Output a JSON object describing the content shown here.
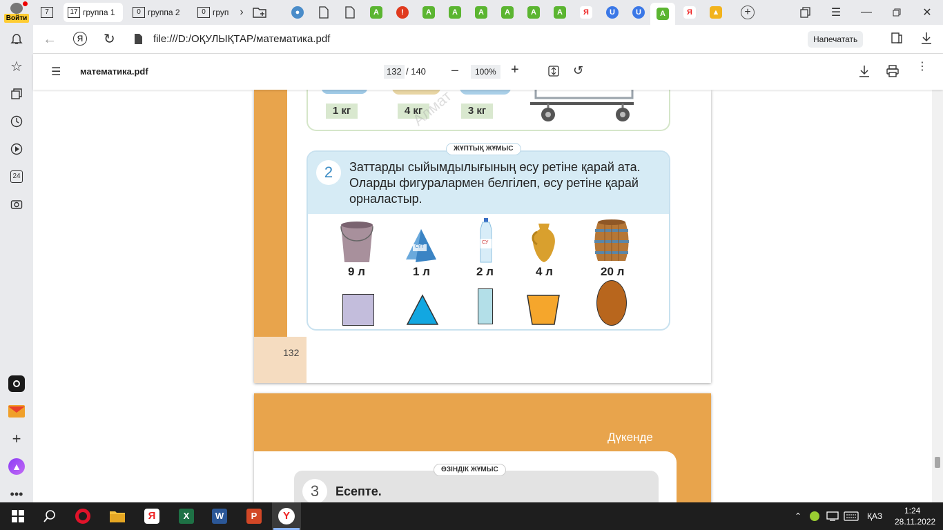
{
  "login_label": "Войти",
  "tabs": {
    "group_count_1": "7",
    "groups": [
      {
        "count": "17",
        "label": "группа 1"
      },
      {
        "count": "0",
        "label": "группа 2"
      },
      {
        "count": "0",
        "label": "груп"
      }
    ]
  },
  "address": {
    "url": "file:///D:/ОҚУЛЫҚТАР/математика.pdf",
    "print_button": "Напечатать"
  },
  "pdf": {
    "filename": "математика.pdf",
    "page_current": "132",
    "page_total": "/ 140",
    "zoom": "100%"
  },
  "page": {
    "weights": [
      "1 кг",
      "4 кг",
      "3 кг"
    ],
    "badge_pair": "ЖҰПТЫҚ ЖҰМЫС",
    "task2_number": "2",
    "task2_text_1": "Заттарды сыйымдылығының өсу ретіне қарай ата.",
    "task2_text_2": "Оларды фигуралармен белгілеп, өсу ретіне қарай",
    "task2_text_3": "орналастыр.",
    "volumes": [
      "9 л",
      "1 л",
      "2 л",
      "4 л",
      "20 л"
    ],
    "milk_label": "СҮТ",
    "water_label": "СУ",
    "page_number": "132",
    "watermark": "Алмат",
    "next_title": "Дүкенде",
    "badge_self": "ӨЗІНДІК ЖҰМЫС",
    "task3_number": "3",
    "task3_text": "Есепте."
  },
  "taskbar": {
    "lang": "ҚАЗ",
    "time": "1:24",
    "date": "28.11.2022"
  },
  "sidebar_badge": "24"
}
